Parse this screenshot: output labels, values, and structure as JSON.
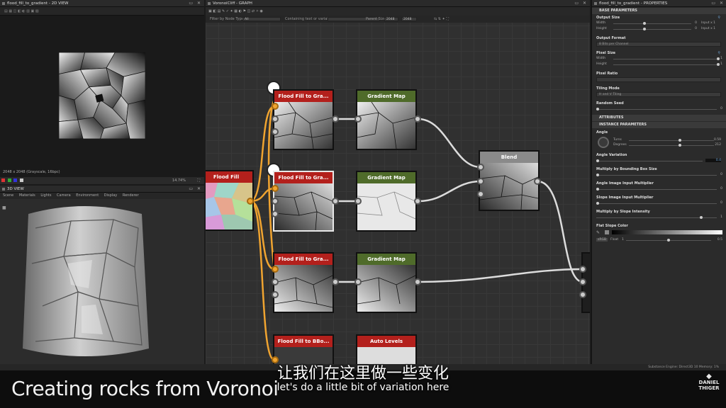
{
  "view2d": {
    "title": "flood_fill_to_gradient - 2D VIEW",
    "info": "2048 x 2048 (Grayscale, 16bpc)",
    "zoom": "14.74%"
  },
  "view3d": {
    "title": "3D VIEW",
    "menu": [
      "Scene",
      "Materials",
      "Lights",
      "Camera",
      "Environment",
      "Display",
      "Renderer"
    ]
  },
  "graph": {
    "title": "VoronoiCliff - GRAPH",
    "filter_label": "Filter by Node Type",
    "filter_value": "All",
    "containing_label": "Containing text or variable",
    "parent_size_label": "Parent Size:",
    "parent_size_value": "2048",
    "size_value": "2048",
    "nodes": {
      "flood_fill": "Flood Fill",
      "ffg1": "Flood Fill to Gra...",
      "ffg2": "Flood Fill to Gra...",
      "ffg3": "Flood Fill to Gra...",
      "ffbb": "Flood Fill to BBo...",
      "gm1": "Gradient Map",
      "gm2": "Gradient Map",
      "gm3": "Gradient Map",
      "auto_levels": "Auto Levels",
      "blend": "Blend"
    },
    "colors": {
      "red": "#b3201c",
      "green": "#4f6b2a",
      "grey": "#8a8a8a",
      "wire_orange": "#f0a430",
      "wire_white": "#dcdcdc"
    }
  },
  "props": {
    "title": "flood_fill_to_gradient - PROPERTIES",
    "sections": {
      "base": "BASE PARAMETERS",
      "attributes": "ATTRIBUTES",
      "instance": "INSTANCE PARAMETERS"
    },
    "output_size": "Output Size",
    "width_label": "Width",
    "height_label": "Height",
    "width_val": "0",
    "height_val": "0",
    "width_mode": "Input x 1",
    "height_mode": "Input x 1",
    "output_format": "Output Format",
    "output_format_value": "8 Bits per Channel",
    "pixel_size": "Pixel Size",
    "px_width_val": "1",
    "px_height_val": "1",
    "pixel_ratio": "Pixel Ratio",
    "tiling_mode": "Tiling Mode",
    "tiling_value": "H and V Tiling",
    "random_seed": "Random Seed",
    "random_seed_val": "0",
    "angle": "Angle",
    "turns_label": "Turns",
    "degrees_label": "Degrees",
    "turns_val": "0.59",
    "degrees_val": "212",
    "angle_variation": "Angle Variation",
    "angle_variation_val": "0.4",
    "mult_bbox": "Multiply by Bounding Box Size",
    "mult_bbox_val": "0",
    "angle_img_mult": "Angle Image Input Multiplier",
    "angle_img_mult_val": "0",
    "slope_img_mult": "Slope Image Input Multiplier",
    "slope_img_mult_val": "0",
    "mult_slope": "Multiply by Slope Intensity",
    "mult_slope_val": "1",
    "flat_slope_color": "Flat Slope Color",
    "float_label": "Float",
    "flat_val_left": "1",
    "flat_val_right": "0.5",
    "srgb": "sRGB"
  },
  "status": {
    "engine": "Substance Engine: Direct3D 10   Memory: 1%"
  },
  "caption": "Creating rocks from Voronoi",
  "subtitle_cn": "让我们在这里做一些变化",
  "subtitle_en": "let's do a little bit of variation here",
  "logo": [
    "DANIEL",
    "THIGER"
  ]
}
